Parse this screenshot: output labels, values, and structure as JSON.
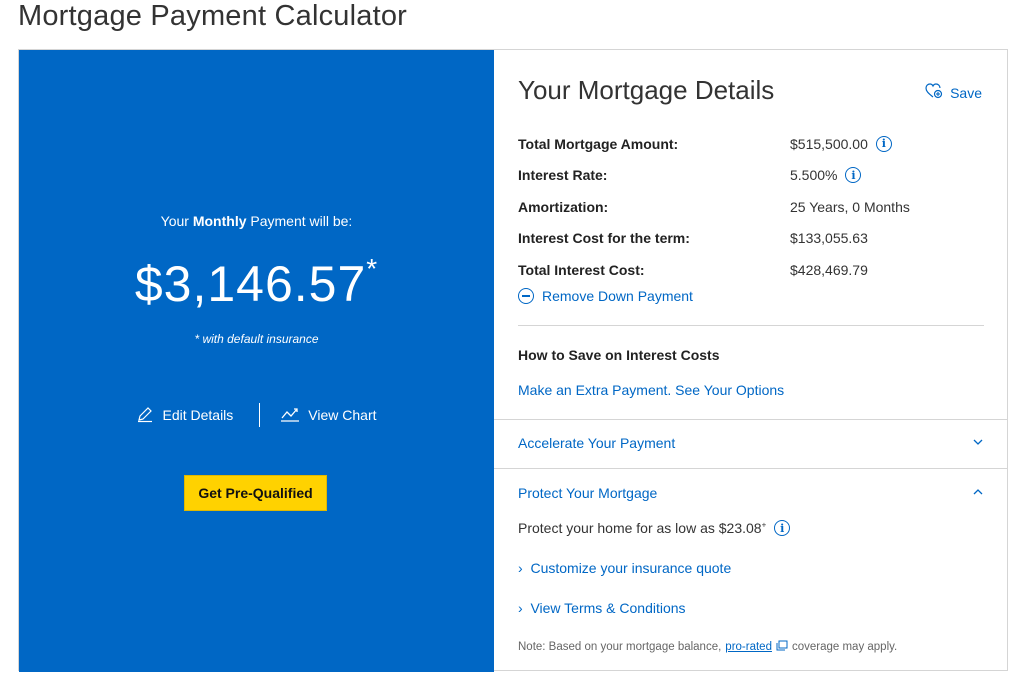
{
  "page": {
    "title": "Mortgage Payment Calculator"
  },
  "summary": {
    "label_prefix": "Your ",
    "label_bold": "Monthly",
    "label_suffix": " Payment will be:",
    "amount": "$3,146.57",
    "asterisk": "*",
    "insurance_note": "* with default insurance",
    "edit_label": "Edit Details",
    "chart_label": "View Chart",
    "prequal_label": "Get Pre-Qualified"
  },
  "details": {
    "title": "Your Mortgage Details",
    "save_label": "Save",
    "rows": [
      {
        "label": "Total Mortgage Amount:",
        "value": "$515,500.00"
      },
      {
        "label": "Interest Rate:",
        "value": "5.500%"
      },
      {
        "label": "Amortization:",
        "value": "25 Years, 0 Months"
      },
      {
        "label": "Interest Cost for the term:",
        "value": "$133,055.63"
      },
      {
        "label": "Total Interest Cost:",
        "value": "$428,469.79"
      }
    ],
    "remove_down_payment": "Remove Down Payment",
    "save_heading": "How to Save on Interest Costs",
    "extra_payment_link": "Make an Extra Payment. See Your Options"
  },
  "accordion": {
    "accelerate_label": "Accelerate Your Payment",
    "protect_label": "Protect Your Mortgage",
    "protect_text": "Protect your home for as low as $23.08",
    "protect_sup": "+",
    "customize_link": "Customize your insurance quote",
    "terms_link": "View Terms & Conditions",
    "note_prefix": "Note: Based on your mortgage balance,",
    "note_link": "pro-rated",
    "note_suffix": "coverage may apply."
  },
  "colors": {
    "brand_blue": "#0067c5",
    "cta_yellow": "#ffd200"
  }
}
